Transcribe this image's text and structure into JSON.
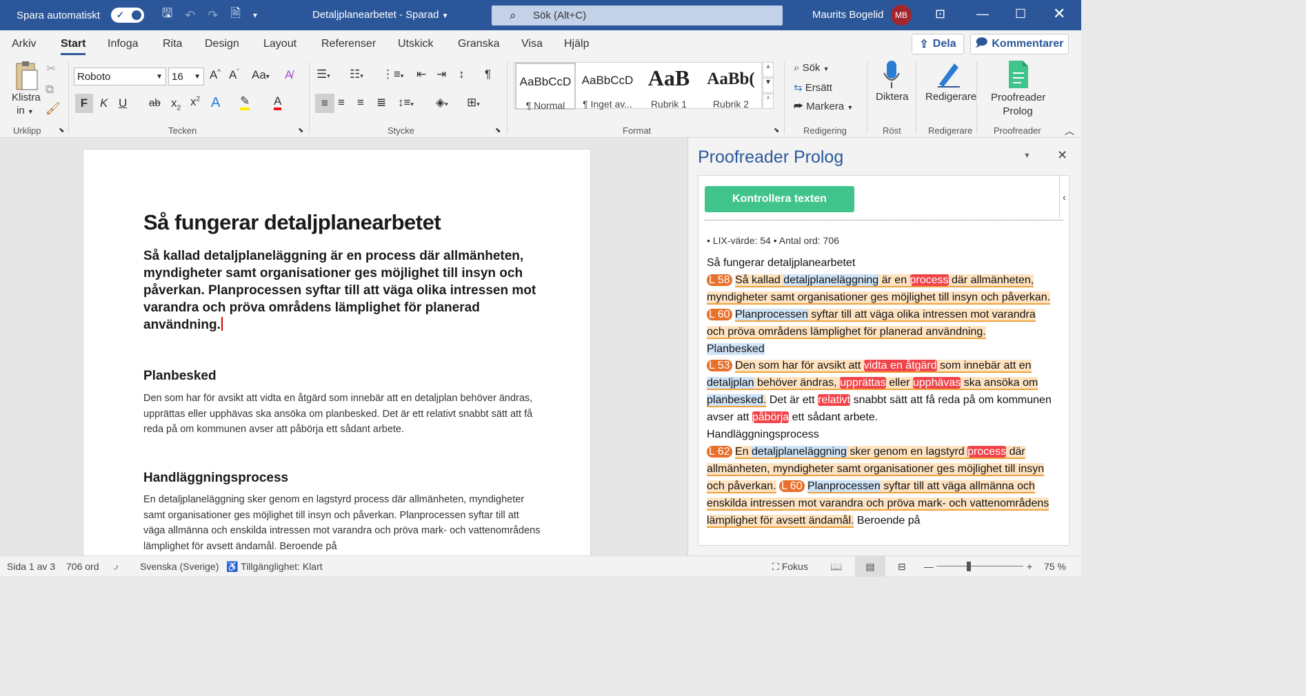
{
  "titlebar": {
    "autosave_label": "Spara automatiskt",
    "doc_title": "Detaljplanearbetet",
    "doc_status": "Sparad",
    "search_placeholder": "Sök (Alt+C)",
    "user_name": "Maurits Bogelid",
    "user_initials": "MB",
    "colors": {
      "bar": "#2b579a",
      "avatar": "#a4262c"
    }
  },
  "menu": {
    "tabs": [
      "Arkiv",
      "Start",
      "Infoga",
      "Rita",
      "Design",
      "Layout",
      "Referenser",
      "Utskick",
      "Granska",
      "Visa",
      "Hjälp"
    ],
    "active_tab": "Start",
    "share_label": "Dela",
    "comments_label": "Kommentarer"
  },
  "ribbon": {
    "clipboard": {
      "paste_label": "Klistra",
      "paste_label2": "in",
      "group": "Urklipp"
    },
    "font": {
      "family": "Roboto",
      "size": "16",
      "bold": "F",
      "italic": "K",
      "underline": "U",
      "strike": "ab",
      "group": "Tecken"
    },
    "paragraph": {
      "group": "Stycke"
    },
    "styles": {
      "items": [
        {
          "preview": "AaBbCcD",
          "name": "¶ Normal"
        },
        {
          "preview": "AaBbCcD",
          "name": "¶ Inget av..."
        },
        {
          "preview": "AaB",
          "name": "Rubrik 1"
        },
        {
          "preview": "AaBb(",
          "name": "Rubrik 2"
        }
      ],
      "group": "Format"
    },
    "editing": {
      "find": "Sök",
      "replace": "Ersätt",
      "select": "Markera",
      "group": "Redigering"
    },
    "voice": {
      "dictate": "Diktera",
      "group": "Röst"
    },
    "editor": {
      "label": "Redigerare",
      "group": "Redigerare"
    },
    "proofreader": {
      "label1": "Proofreader",
      "label2": "Prolog",
      "group": "Proofreader"
    }
  },
  "document": {
    "title": "Så fungerar detaljplanearbetet",
    "lead": "Så kallad detaljplaneläggning är en process där allmänheten, myndigheter samt organisationer ges möjlighet till insyn och påverkan. Planprocessen syftar till att väga olika intressen mot varandra och pröva områdens lämplighet för planerad användning.",
    "h_planbesked": "Planbesked",
    "p_planbesked": "Den som har för avsikt att vidta en åtgärd som innebär att en detaljplan behöver ändras, upprättas eller upphävas ska ansöka om planbesked. Det är ett relativt snabbt sätt att få reda på om kommunen avser att påbörja ett sådant arbete.",
    "h_process": "Handläggningsprocess",
    "p_process": "En detaljplaneläggning sker genom en lagstyrd process där allmänheten, myndigheter samt organisationer ges möjlighet till insyn och påverkan. Planprocessen syftar till att väga allmänna och enskilda intressen mot varandra och pröva mark- och vattenområdens lämplighet för avsett ändamål. Beroende på"
  },
  "pane": {
    "title": "Proofreader Prolog",
    "check_button": "Kontrollera texten",
    "stats": "• LIX-värde: 54 • Antal ord: 706",
    "heading1": "Så fungerar detaljplanearbetet",
    "heading2": "Planbesked",
    "heading3": "Handläggningsprocess",
    "lix": [
      "L 58",
      "L 60",
      "L 53",
      "L 62",
      "L 60"
    ],
    "colors": {
      "button": "#40c48c",
      "lix": "#e9702a",
      "hard": "#ffe3c1",
      "error": "#f0444a",
      "term": "#cfe3f7"
    }
  },
  "statusbar": {
    "page": "Sida 1 av 3",
    "words": "706 ord",
    "language": "Svenska (Sverige)",
    "accessibility": "Tillgänglighet: Klart",
    "focus": "Fokus",
    "zoom": "75 %"
  }
}
